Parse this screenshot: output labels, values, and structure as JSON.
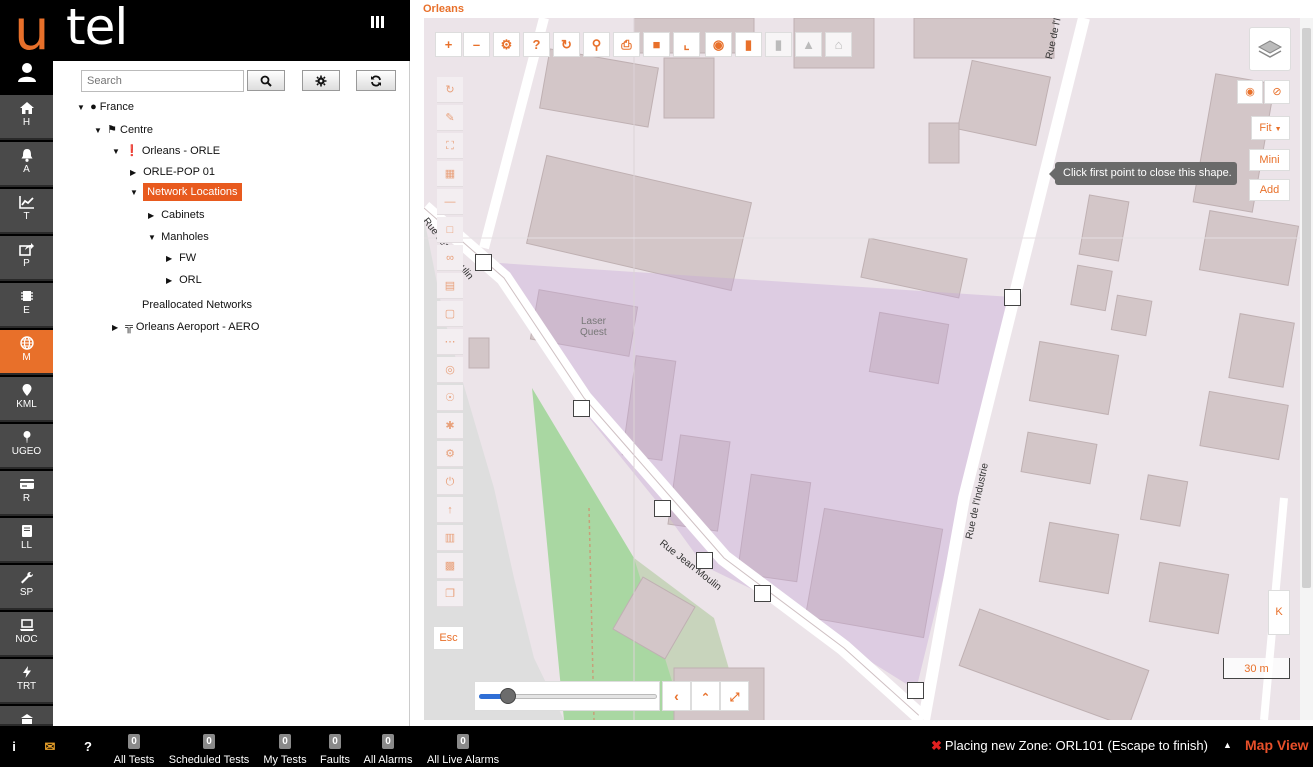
{
  "brand": {
    "logo_u": "u",
    "logo_tel": "tel"
  },
  "nav": {
    "items": [
      {
        "label": "H",
        "icon": "home-icon"
      },
      {
        "label": "A",
        "icon": "bell-icon"
      },
      {
        "label": "T",
        "icon": "chart-icon"
      },
      {
        "label": "P",
        "icon": "share-icon"
      },
      {
        "label": "E",
        "icon": "chip-icon"
      },
      {
        "label": "M",
        "icon": "globe-icon",
        "active": true
      },
      {
        "label": "KML",
        "icon": "map-pin-icon"
      },
      {
        "label": "UGEO",
        "icon": "pin-icon"
      },
      {
        "label": "R",
        "icon": "card-icon"
      },
      {
        "label": "LL",
        "icon": "book-icon"
      },
      {
        "label": "SP",
        "icon": "wrench-icon"
      },
      {
        "label": "NOC",
        "icon": "laptop-icon"
      },
      {
        "label": "TRT",
        "icon": "bolt-icon"
      }
    ]
  },
  "tree": {
    "search_placeholder": "Search",
    "nodes": {
      "france": "France",
      "centre": "Centre",
      "orleans": "Orleans - ORLE",
      "pop": "ORLE-POP 01",
      "network_locations": "Network Locations",
      "cabinets": "Cabinets",
      "manholes": "Manholes",
      "fw": "FW",
      "orl": "ORL",
      "preallocated": "Preallocated Networks",
      "aeroport": "Orleans Aeroport - AERO"
    }
  },
  "map": {
    "title": "Orleans",
    "tooltip": "Click first point to close this shape.",
    "fit_label": "Fit",
    "mini_label": "Mini",
    "add_label": "Add",
    "esc_label": "Esc",
    "k_label": "K",
    "scale_label": "30 m",
    "streets": {
      "rue_industrie_top": "Rue de l'Industrie",
      "rue_industrie_mid": "Rue de l'Industrie",
      "rue_jean_moulin_top": "Rue Jean Moulin",
      "rue_jean_moulin_mid": "Rue Jean Moulin",
      "place_laser": "Laser",
      "place_quest": "Quest"
    },
    "colors": {
      "accent": "#e8702a",
      "zone_fill": "#c9a8d8",
      "park": "#9fd39a"
    }
  },
  "status_bar": {
    "stats": [
      {
        "label": "All Tests",
        "count": "0"
      },
      {
        "label": "Scheduled Tests",
        "count": "0"
      },
      {
        "label": "My Tests",
        "count": "0"
      },
      {
        "label": "Faults",
        "count": "0"
      },
      {
        "label": "All Alarms",
        "count": "0"
      },
      {
        "label": "All Live Alarms",
        "count": "0"
      }
    ],
    "zone_message": "Placing new Zone: ORL101 (Escape to finish)",
    "map_view": "Map View"
  }
}
